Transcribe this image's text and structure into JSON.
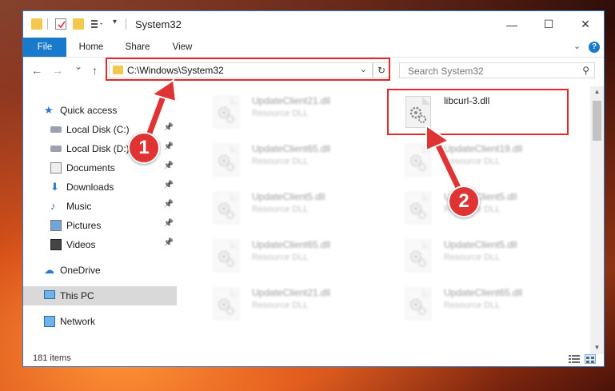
{
  "window": {
    "title": "System32",
    "controls": {
      "minimize": "—",
      "maximize": "☐",
      "close": "✕"
    }
  },
  "ribbon": {
    "tabs": [
      "File",
      "Home",
      "Share",
      "View"
    ],
    "expand_icon": "chevron-down-icon",
    "help_icon": "help-icon"
  },
  "navigation": {
    "back": "←",
    "forward": "→",
    "recent": "⌄",
    "up": "↑",
    "address": "C:\\Windows\\System32",
    "refresh": "↻",
    "search_placeholder": "Search System32"
  },
  "sidebar": {
    "items": [
      {
        "label": "Quick access",
        "icon": "star-icon",
        "pinned": false
      },
      {
        "label": "Local Disk (C:)",
        "icon": "drive-icon",
        "pinned": true
      },
      {
        "label": "Local Disk (D:)",
        "icon": "drive-icon",
        "pinned": true
      },
      {
        "label": "Documents",
        "icon": "documents-icon",
        "pinned": true
      },
      {
        "label": "Downloads",
        "icon": "download-icon",
        "pinned": true
      },
      {
        "label": "Music",
        "icon": "music-icon",
        "pinned": true
      },
      {
        "label": "Pictures",
        "icon": "pictures-icon",
        "pinned": true
      },
      {
        "label": "Videos",
        "icon": "videos-icon",
        "pinned": true
      },
      {
        "label": "OneDrive",
        "icon": "cloud-icon",
        "pinned": false
      },
      {
        "label": "This PC",
        "icon": "computer-icon",
        "pinned": false,
        "selected": true
      },
      {
        "label": "Network",
        "icon": "network-icon",
        "pinned": false
      }
    ]
  },
  "files": [
    {
      "name": "UpdateClient21.dll",
      "type": "Resource DLL",
      "blurred": true
    },
    {
      "name": "libcurl-3.dll",
      "type": "",
      "blurred": false
    },
    {
      "name": "UpdateClient65.dll",
      "type": "Resource DLL",
      "blurred": true
    },
    {
      "name": "UpdateClient19.dll",
      "type": "Resource DLL",
      "blurred": true
    },
    {
      "name": "UpdateClient5.dll",
      "type": "Resource DLL",
      "blurred": true
    },
    {
      "name": "UpdateClient5.dll",
      "type": "Resource DLL",
      "blurred": true
    },
    {
      "name": "UpdateClient65.dll",
      "type": "Resource DLL",
      "blurred": true
    },
    {
      "name": "UpdateClient5.dll",
      "type": "Resource DLL",
      "blurred": true
    },
    {
      "name": "UpdateClient21.dll",
      "type": "Resource DLL",
      "blurred": true
    },
    {
      "name": "UpdateClient65.dll",
      "type": "Resource DLL",
      "blurred": true
    }
  ],
  "status": {
    "count": "181 items"
  },
  "annotations": {
    "badge1": "1",
    "badge2": "2",
    "highlight_color": "#e02a2a"
  }
}
